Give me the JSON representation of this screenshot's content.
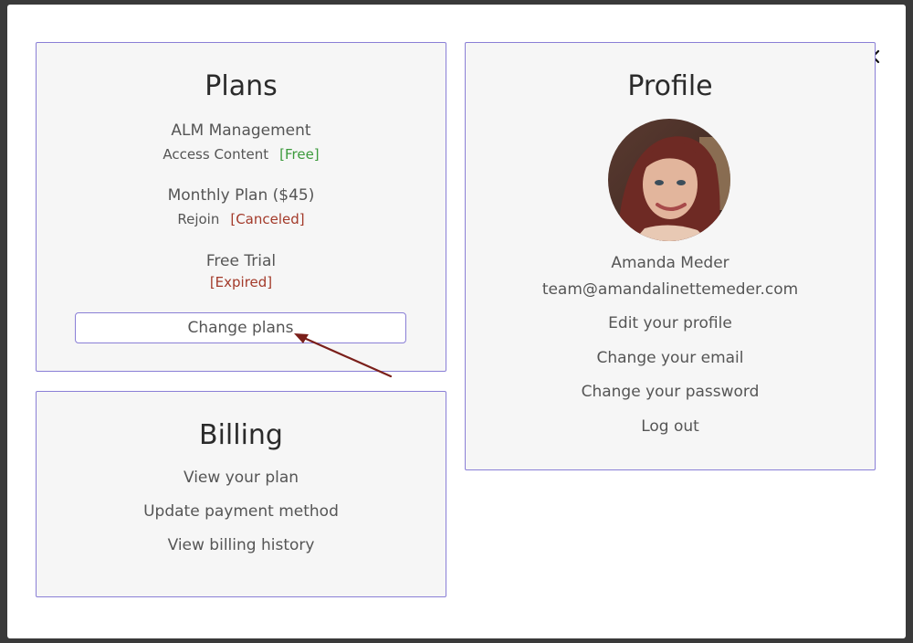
{
  "plans": {
    "title": "Plans",
    "items": [
      {
        "name": "ALM Management",
        "action": "Access Content",
        "status": "[Free]"
      },
      {
        "name": "Monthly Plan ($45)",
        "action": "Rejoin",
        "status": "[Canceled]"
      },
      {
        "name": "Free Trial",
        "status": "[Expired]"
      }
    ],
    "change_button": "Change plans"
  },
  "billing": {
    "title": "Billing",
    "links": [
      "View your plan",
      "Update payment method",
      "View billing history"
    ]
  },
  "profile": {
    "title": "Profile",
    "name": "Amanda Meder",
    "email": "team@amandalinettemeder.com",
    "links": [
      "Edit your profile",
      "Change your email",
      "Change your password",
      "Log out"
    ]
  },
  "colors": {
    "border": "#8a7fd6",
    "free": "#3c9a3c",
    "canceled": "#a33a2a",
    "arrow": "#7a1f1a"
  },
  "icons": {
    "close": "close-icon",
    "avatar": "avatar"
  }
}
